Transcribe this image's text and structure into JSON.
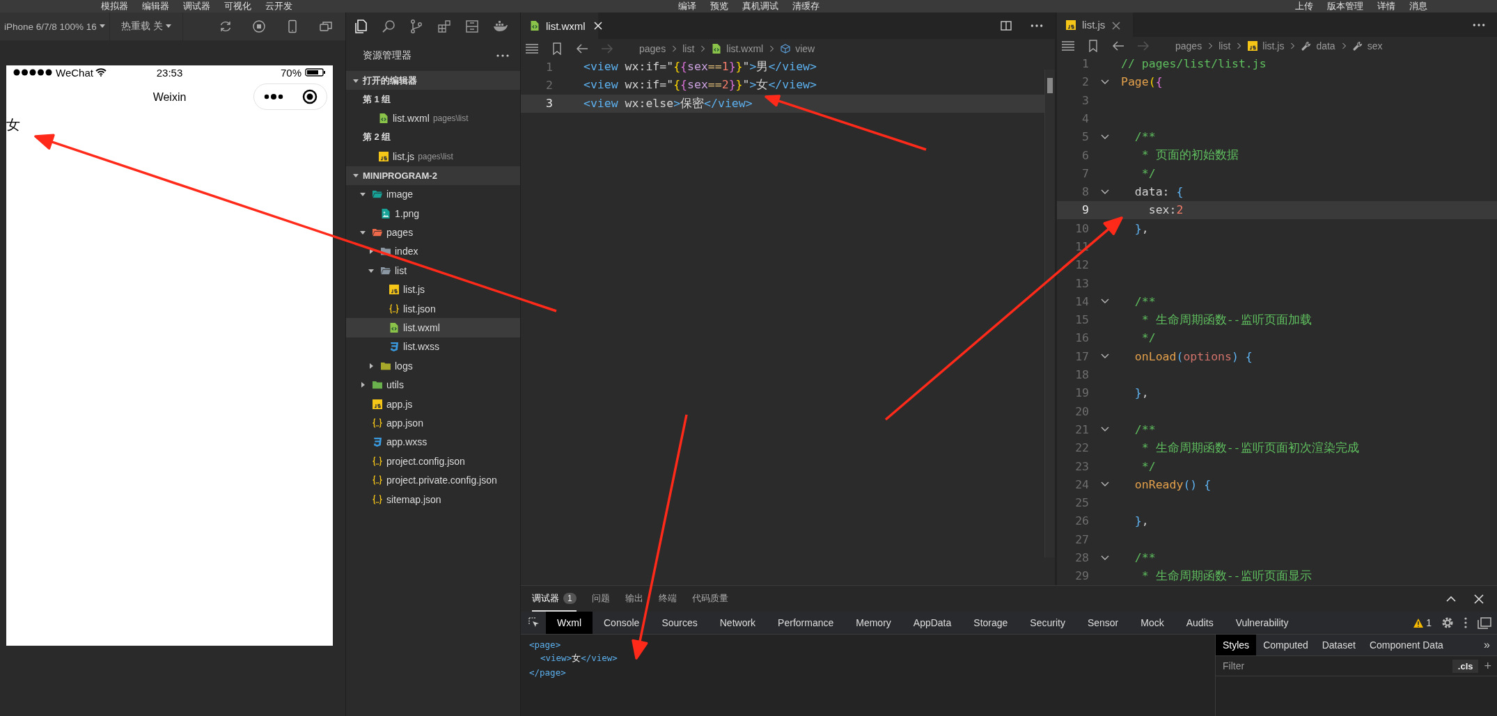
{
  "menu_bar": {
    "left": [
      "模拟器",
      "编辑器",
      "调试器",
      "可视化",
      "云开发"
    ],
    "center": [
      "编译",
      "预览",
      "真机调试",
      "清缓存"
    ],
    "right": [
      "上传",
      "版本管理",
      "详情",
      "消息"
    ]
  },
  "simulator": {
    "device": "iPhone 6/7/8 100% 16",
    "hot_reload": "热重载 关",
    "phone": {
      "carrier": "WeChat",
      "time": "23:53",
      "battery": "70%",
      "nav_title": "Weixin",
      "content": "女"
    }
  },
  "explorer": {
    "title": "资源管理器",
    "open_editors": {
      "label": "打开的编辑器",
      "expanded": true,
      "groups": [
        {
          "label": "第 1 组",
          "files": [
            {
              "name": "list.wxml",
              "kind": "wxml",
              "path": "pages\\list"
            }
          ]
        },
        {
          "label": "第 2 组",
          "files": [
            {
              "name": "list.js",
              "kind": "js",
              "path": "pages\\list"
            }
          ]
        }
      ]
    },
    "project": {
      "label": "MINIPROGRAM-2",
      "expanded": true,
      "tree": [
        {
          "name": "image",
          "kind": "folder",
          "color": "#17a398",
          "expanded": true,
          "selected": false,
          "children": [
            {
              "name": "1.png",
              "kind": "image",
              "selected": false
            }
          ]
        },
        {
          "name": "pages",
          "kind": "folder",
          "color": "#ef6a4a",
          "expanded": true,
          "selected": false,
          "children": [
            {
              "name": "index",
              "kind": "folder",
              "color": "#8a97a3",
              "expanded": false,
              "selected": false
            },
            {
              "name": "list",
              "kind": "folder",
              "color": "#8a97a3",
              "expanded": true,
              "selected": false,
              "children": [
                {
                  "name": "list.js",
                  "kind": "js",
                  "selected": false
                },
                {
                  "name": "list.json",
                  "kind": "json",
                  "selected": false
                },
                {
                  "name": "list.wxml",
                  "kind": "wxml",
                  "selected": true
                },
                {
                  "name": "list.wxss",
                  "kind": "wxss",
                  "selected": false
                }
              ]
            },
            {
              "name": "logs",
              "kind": "folder",
              "color": "#a8a82a",
              "expanded": false,
              "selected": false
            }
          ]
        },
        {
          "name": "utils",
          "kind": "folder",
          "color": "#6ab04c",
          "expanded": false,
          "selected": false
        },
        {
          "name": "app.js",
          "kind": "js",
          "selected": false
        },
        {
          "name": "app.json",
          "kind": "json",
          "selected": false
        },
        {
          "name": "app.wxss",
          "kind": "wxss",
          "selected": false
        },
        {
          "name": "project.config.json",
          "kind": "json",
          "selected": false
        },
        {
          "name": "project.private.config.json",
          "kind": "json",
          "selected": false
        },
        {
          "name": "sitemap.json",
          "kind": "json",
          "selected": false
        }
      ]
    }
  },
  "editors": [
    {
      "tab": "list.wxml",
      "kind": "wxml",
      "breadcrumb": [
        {
          "text": "pages",
          "kind": "folder"
        },
        {
          "text": "list",
          "kind": "folder"
        },
        {
          "text": "list.wxml",
          "kind": "wxml"
        },
        {
          "text": "view",
          "kind": "element"
        }
      ],
      "lines": [
        {
          "n": "1",
          "current": false,
          "tokens": [
            {
              "kind": "tag",
              "text": "<view"
            },
            {
              "kind": "plain",
              "text": " wx:if=\""
            },
            {
              "kind": "b1",
              "text": "{"
            },
            {
              "kind": "b2",
              "text": "{"
            },
            {
              "kind": "var",
              "text": "sex"
            },
            {
              "kind": "op",
              "text": "=="
            },
            {
              "kind": "num",
              "text": "1"
            },
            {
              "kind": "b2",
              "text": "}"
            },
            {
              "kind": "b1",
              "text": "}"
            },
            {
              "kind": "plain",
              "text": "\""
            },
            {
              "kind": "tag",
              "text": ">"
            },
            {
              "kind": "plain",
              "text": "男"
            },
            {
              "kind": "tag",
              "text": "</view>"
            }
          ]
        },
        {
          "n": "2",
          "current": false,
          "tokens": [
            {
              "kind": "tag",
              "text": "<view"
            },
            {
              "kind": "plain",
              "text": " wx:if=\""
            },
            {
              "kind": "b1",
              "text": "{"
            },
            {
              "kind": "b2",
              "text": "{"
            },
            {
              "kind": "var",
              "text": "sex"
            },
            {
              "kind": "op",
              "text": "=="
            },
            {
              "kind": "num",
              "text": "2"
            },
            {
              "kind": "b2",
              "text": "}"
            },
            {
              "kind": "b1",
              "text": "}"
            },
            {
              "kind": "plain",
              "text": "\""
            },
            {
              "kind": "tag",
              "text": ">"
            },
            {
              "kind": "plain",
              "text": "女"
            },
            {
              "kind": "tag",
              "text": "</view>"
            }
          ]
        },
        {
          "n": "3",
          "current": true,
          "tokens": [
            {
              "kind": "tag",
              "text": "<view"
            },
            {
              "kind": "plain",
              "text": " wx:else"
            },
            {
              "kind": "tag",
              "text": ">"
            },
            {
              "kind": "plain",
              "text": "保密"
            },
            {
              "kind": "tag",
              "text": "</view>"
            }
          ]
        }
      ]
    },
    {
      "tab": "list.js",
      "kind": "js",
      "breadcrumb": [
        {
          "text": "pages",
          "kind": "folder"
        },
        {
          "text": "list",
          "kind": "folder"
        },
        {
          "text": "list.js",
          "kind": "js"
        },
        {
          "text": "data",
          "kind": "property"
        },
        {
          "text": "sex",
          "kind": "property"
        }
      ],
      "lines": [
        {
          "n": "1",
          "current": false,
          "fold": false,
          "tokens": [
            {
              "kind": "comment",
              "text": "// pages/list/list.js"
            }
          ]
        },
        {
          "n": "2",
          "current": false,
          "fold": true,
          "tokens": [
            {
              "kind": "fn",
              "text": "Page"
            },
            {
              "kind": "b1",
              "text": "("
            },
            {
              "kind": "b2",
              "text": "{"
            }
          ]
        },
        {
          "n": "3",
          "current": false,
          "fold": false
        },
        {
          "n": "4",
          "current": false,
          "fold": false
        },
        {
          "n": "5",
          "current": false,
          "fold": true,
          "tokens": [
            {
              "kind": "comment",
              "text": "  /**"
            }
          ]
        },
        {
          "n": "6",
          "current": false,
          "fold": false,
          "tokens": [
            {
              "kind": "comment",
              "text": "   * 页面的初始数据"
            }
          ]
        },
        {
          "n": "7",
          "current": false,
          "fold": false,
          "tokens": [
            {
              "kind": "comment",
              "text": "   */"
            }
          ]
        },
        {
          "n": "8",
          "current": false,
          "fold": true,
          "tokens": [
            {
              "kind": "plain",
              "text": "  data: "
            },
            {
              "kind": "bracket",
              "text": "{"
            }
          ]
        },
        {
          "n": "9",
          "current": true,
          "fold": false,
          "tokens": [
            {
              "kind": "plain",
              "text": "    sex:"
            },
            {
              "kind": "num",
              "text": "2"
            }
          ]
        },
        {
          "n": "10",
          "current": false,
          "fold": false,
          "tokens": [
            {
              "kind": "bracket",
              "text": "  }"
            },
            {
              "kind": "plain",
              "text": ","
            }
          ]
        },
        {
          "n": "11",
          "current": false,
          "fold": false
        },
        {
          "n": "12",
          "current": false,
          "fold": false
        },
        {
          "n": "13",
          "current": false,
          "fold": false
        },
        {
          "n": "14",
          "current": false,
          "fold": true,
          "tokens": [
            {
              "kind": "comment",
              "text": "  /**"
            }
          ]
        },
        {
          "n": "15",
          "current": false,
          "fold": false,
          "tokens": [
            {
              "kind": "comment",
              "text": "   * 生命周期函数--监听页面加载"
            }
          ]
        },
        {
          "n": "16",
          "current": false,
          "fold": false,
          "tokens": [
            {
              "kind": "comment",
              "text": "   */"
            }
          ]
        },
        {
          "n": "17",
          "current": false,
          "fold": true,
          "tokens": [
            {
              "kind": "fn",
              "text": "  onLoad"
            },
            {
              "kind": "bracket",
              "text": "("
            },
            {
              "kind": "param",
              "text": "options"
            },
            {
              "kind": "bracket",
              "text": ") {"
            }
          ]
        },
        {
          "n": "18",
          "current": false,
          "fold": false
        },
        {
          "n": "19",
          "current": false,
          "fold": false,
          "tokens": [
            {
              "kind": "bracket",
              "text": "  }"
            },
            {
              "kind": "plain",
              "text": ","
            }
          ]
        },
        {
          "n": "20",
          "current": false,
          "fold": false
        },
        {
          "n": "21",
          "current": false,
          "fold": true,
          "tokens": [
            {
              "kind": "comment",
              "text": "  /**"
            }
          ]
        },
        {
          "n": "22",
          "current": false,
          "fold": false,
          "tokens": [
            {
              "kind": "comment",
              "text": "   * 生命周期函数--监听页面初次渲染完成"
            }
          ]
        },
        {
          "n": "23",
          "current": false,
          "fold": false,
          "tokens": [
            {
              "kind": "comment",
              "text": "   */"
            }
          ]
        },
        {
          "n": "24",
          "current": false,
          "fold": true,
          "tokens": [
            {
              "kind": "fn",
              "text": "  onReady"
            },
            {
              "kind": "bracket",
              "text": "() {"
            }
          ]
        },
        {
          "n": "25",
          "current": false,
          "fold": false
        },
        {
          "n": "26",
          "current": false,
          "fold": false,
          "tokens": [
            {
              "kind": "bracket",
              "text": "  }"
            },
            {
              "kind": "plain",
              "text": ","
            }
          ]
        },
        {
          "n": "27",
          "current": false,
          "fold": false
        },
        {
          "n": "28",
          "current": false,
          "fold": true,
          "tokens": [
            {
              "kind": "comment",
              "text": "  /**"
            }
          ]
        },
        {
          "n": "29",
          "current": false,
          "fold": false,
          "tokens": [
            {
              "kind": "comment",
              "text": "   * 生命周期函数--监听页面显示"
            }
          ]
        }
      ]
    }
  ],
  "debug_panel": {
    "tabs": [
      {
        "label": "调试器",
        "selected": true,
        "badge": "1"
      },
      {
        "label": "问题",
        "selected": false
      },
      {
        "label": "输出",
        "selected": false
      },
      {
        "label": "终端",
        "selected": false
      },
      {
        "label": "代码质量",
        "selected": false
      }
    ],
    "devtools_tabs": [
      {
        "label": "Wxml",
        "selected": true
      },
      {
        "label": "Console",
        "selected": false
      },
      {
        "label": "Sources",
        "selected": false
      },
      {
        "label": "Network",
        "selected": false
      },
      {
        "label": "Performance",
        "selected": false
      },
      {
        "label": "Memory",
        "selected": false
      },
      {
        "label": "AppData",
        "selected": false
      },
      {
        "label": "Storage",
        "selected": false
      },
      {
        "label": "Security",
        "selected": false
      },
      {
        "label": "Sensor",
        "selected": false
      },
      {
        "label": "Mock",
        "selected": false
      },
      {
        "label": "Audits",
        "selected": false
      },
      {
        "label": "Vulnerability",
        "selected": false
      }
    ],
    "warnings": "1",
    "wxml_tree": [
      {
        "open": "<page>",
        "close": "</page>",
        "children": [
          {
            "open": "<view>",
            "text": "女",
            "close": "</view>"
          }
        ]
      }
    ],
    "side_tabs": [
      {
        "label": "Styles",
        "selected": true
      },
      {
        "label": "Computed",
        "selected": false
      },
      {
        "label": "Dataset",
        "selected": false
      },
      {
        "label": "Component Data",
        "selected": false
      }
    ],
    "more_tabs": "»",
    "filter_placeholder": "Filter",
    "cls": ".cls",
    "add": "+"
  }
}
